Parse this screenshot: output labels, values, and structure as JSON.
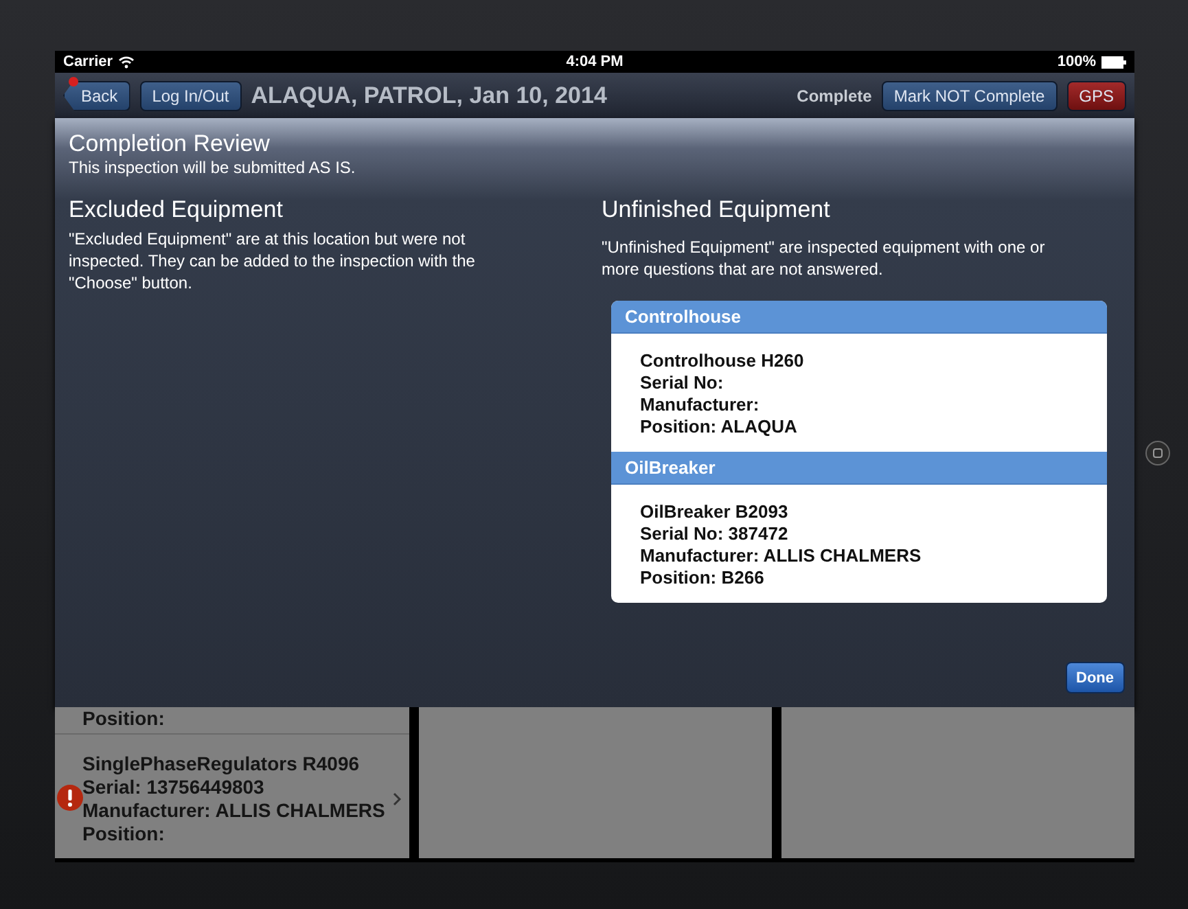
{
  "status_bar": {
    "carrier": "Carrier",
    "time": "4:04 PM",
    "battery": "100%"
  },
  "nav_bar": {
    "back_button": "Back",
    "login_button": "Log In/Out",
    "title": "ALAQUA, PATROL, Jan 10, 2014",
    "status": "Complete",
    "mark_button": "Mark NOT Complete",
    "gps_button": "GPS"
  },
  "modal": {
    "title": "Completion Review",
    "subtitle": "This inspection will be submitted AS IS.",
    "excluded": {
      "heading": "Excluded Equipment",
      "description": "\"Excluded Equipment\" are at this location but were not inspected. They can be added to the inspection with the \"Choose\" button."
    },
    "unfinished": {
      "heading": "Unfinished Equipment",
      "description": "\"Unfinished Equipment\" are inspected equipment with one or more questions that are not answered.",
      "groups": [
        {
          "name": "Controlhouse",
          "lines": [
            "Controlhouse H260",
            "Serial No:",
            "Manufacturer:",
            "Position: ALAQUA"
          ]
        },
        {
          "name": "OilBreaker",
          "lines": [
            "OilBreaker B2093",
            "Serial No: 387472",
            "Manufacturer: ALLIS CHALMERS",
            "Position: B266"
          ]
        }
      ]
    },
    "done_button": "Done"
  },
  "background_list": {
    "rows": [
      {
        "lines": [
          "Position:"
        ],
        "warning": false
      },
      {
        "lines": [
          "SinglePhaseRegulators R4096",
          "Serial: 13756449803",
          "Manufacturer: ALLIS CHALMERS",
          "Position:"
        ],
        "warning": true
      }
    ]
  }
}
